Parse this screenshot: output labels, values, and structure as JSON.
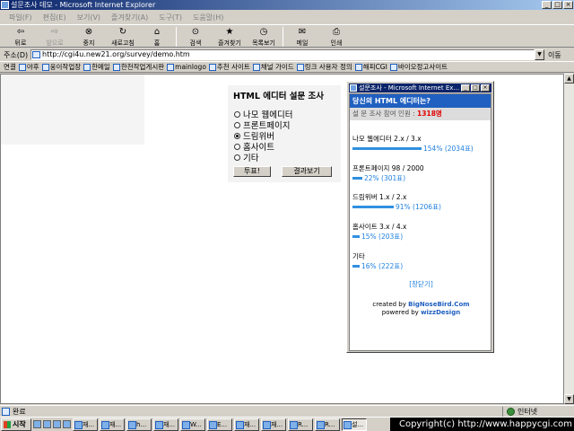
{
  "window": {
    "title": "설문조사 데모 - Microsoft Internet Explorer",
    "btn_min": "_",
    "btn_max": "□",
    "btn_close": "×"
  },
  "menu": [
    "파일(F)",
    "편집(E)",
    "보기(V)",
    "즐겨찾기(A)",
    "도구(T)",
    "도움말(H)"
  ],
  "toolbar": [
    {
      "label": "뒤로",
      "icon": "back-arrow-icon",
      "glyph": "⇦",
      "enabled": true
    },
    {
      "label": "앞으로",
      "icon": "forward-arrow-icon",
      "glyph": "⇨",
      "enabled": false
    },
    {
      "label": "중지",
      "icon": "stop-icon",
      "glyph": "⊗",
      "enabled": true
    },
    {
      "label": "새로고침",
      "icon": "refresh-icon",
      "glyph": "↻",
      "enabled": true
    },
    {
      "label": "홈",
      "icon": "home-icon",
      "glyph": "⌂",
      "enabled": true
    },
    {
      "label": "검색",
      "icon": "search-icon",
      "glyph": "⊙",
      "enabled": true
    },
    {
      "label": "즐겨찾기",
      "icon": "favorites-icon",
      "glyph": "★",
      "enabled": true
    },
    {
      "label": "목록보기",
      "icon": "history-icon",
      "glyph": "◷",
      "enabled": true
    },
    {
      "label": "메일",
      "icon": "mail-icon",
      "glyph": "✉",
      "enabled": true
    },
    {
      "label": "인쇄",
      "icon": "print-icon",
      "glyph": "⎙",
      "enabled": true
    }
  ],
  "address": {
    "label": "주소(D)",
    "url": "http://cgi4u.new21.org/survey/demo.htm",
    "go": "이동"
  },
  "links": {
    "label": "연결",
    "items": [
      "야후",
      "웅이작업장",
      "한메일",
      "한천작업게시판",
      "mainlogo",
      "추천 사이트",
      "채널 가이드",
      "링크 사용자 정의",
      "해피CGI",
      "바이오정고사이트"
    ]
  },
  "survey": {
    "title": "HTML 에디터 설문 조사",
    "options": [
      {
        "label": "나모 웹에디터",
        "checked": false
      },
      {
        "label": "프론트페이지",
        "checked": false
      },
      {
        "label": "드림위버",
        "checked": true
      },
      {
        "label": "홈사이트",
        "checked": false
      },
      {
        "label": "기타",
        "checked": false
      }
    ],
    "vote_button": "투표!",
    "result_button": "결과보기"
  },
  "popup": {
    "title": "설문조사 - Microsoft Internet Ex...",
    "question": "당신의 HTML 에디터는?",
    "count_label": "설 문 조사 참여 인원 :",
    "count_value": "1318명",
    "results": [
      {
        "label": "나모 웹에디터 2.x / 3.x",
        "percent": 154,
        "text": "154% (2034표)"
      },
      {
        "label": "프론트페이지 98 / 2000",
        "percent": 22,
        "text": "22% (301표)"
      },
      {
        "label": "드림위버 1.x / 2.x",
        "percent": 91,
        "text": "91% (1206표)"
      },
      {
        "label": "홈사이트 3.x / 4.x",
        "percent": 15,
        "text": "15% (203표)"
      },
      {
        "label": "기타",
        "percent": 16,
        "text": "16% (222표)"
      }
    ],
    "close_link": "[창닫기]",
    "credit_line1_prefix": "created by ",
    "credit_line1_name": "BigNoseBird.Com",
    "credit_line2_prefix": "powered by ",
    "credit_line2_name": "wizzDesign"
  },
  "status": {
    "text": "완료",
    "zone": "인터넷"
  },
  "taskbar": {
    "start": "시작",
    "tasks": [
      "재...",
      "재...",
      "h...",
      "재...",
      "W...",
      "E...",
      "재...",
      "재...",
      "R...",
      "R...",
      "설..."
    ],
    "tray_text": "Copyright(c) http://www.happycgi.com"
  },
  "colors": {
    "accent": "#2060c0",
    "bar": "#3090e0",
    "count": "#e00000"
  }
}
